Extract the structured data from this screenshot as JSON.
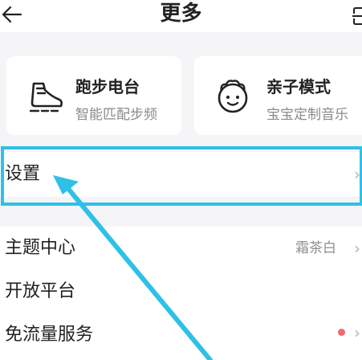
{
  "header": {
    "title": "更多"
  },
  "cards": [
    {
      "title": "跑步电台",
      "subtitle": "智能匹配步频",
      "icon": "running-shoe-icon"
    },
    {
      "title": "亲子模式",
      "subtitle": "宝宝定制音乐",
      "icon": "baby-face-icon"
    }
  ],
  "menu": {
    "settings": {
      "label": "设置"
    },
    "theme": {
      "label": "主题中心",
      "value": "霜茶白"
    },
    "open_platform": {
      "label": "开放平台"
    },
    "free_flow": {
      "label": "免流量服务"
    }
  },
  "chevron": "›",
  "colors": {
    "highlight": "#2ec0e8",
    "badge_dot": "#f26a6a",
    "background": "#f5f5f7"
  }
}
